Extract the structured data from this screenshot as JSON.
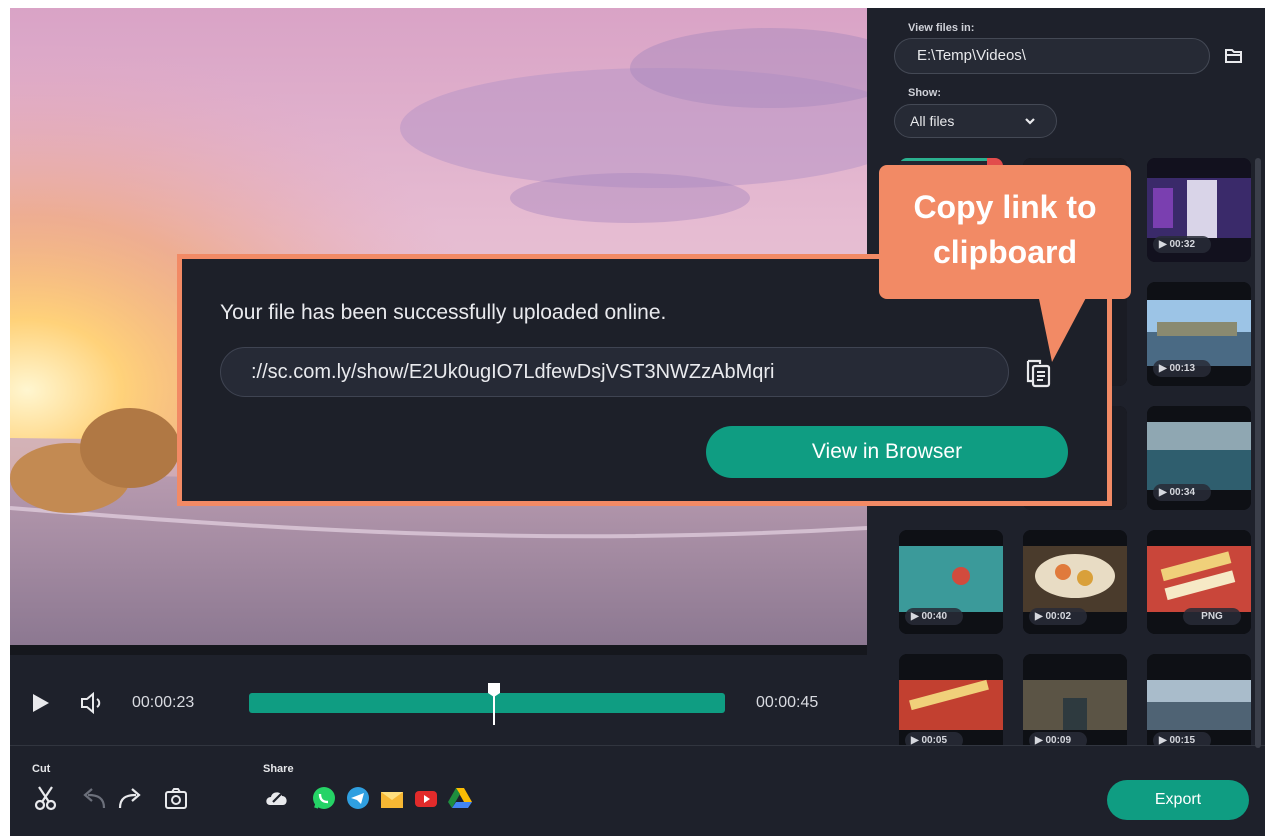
{
  "player": {
    "current_time": "00:00:23",
    "total_time": "00:00:45",
    "progress": 0.51
  },
  "side_panel": {
    "view_files_label": "View files in:",
    "path": "E:\\Temp\\Videos\\",
    "show_label": "Show:",
    "show_value": "All files",
    "thumbnails": [
      {
        "badge": ""
      },
      {
        "badge": ""
      },
      {
        "badge": "▶ 00:32"
      },
      {
        "badge": "▶ 00:13"
      },
      {
        "badge": "▶ 00:34"
      },
      {
        "badge": "▶ 00:40"
      },
      {
        "badge": "▶ 00:02"
      },
      {
        "badge": "PNG"
      },
      {
        "badge": "▶ 00:05"
      },
      {
        "badge": "▶ 00:09"
      },
      {
        "badge": "▶ 00:15"
      }
    ]
  },
  "toolbar": {
    "cut_label": "Cut",
    "share_label": "Share",
    "export_label": "Export"
  },
  "dialog": {
    "message": "Your file has been successfully uploaded online.",
    "link": "://sc.com.ly/show/E2Uk0ugIO7LdfewDsjVST3NWZzAbMqri",
    "view_button": "View in Browser"
  },
  "callout": {
    "text_line1": "Copy link to",
    "text_line2": "clipboard"
  },
  "colors": {
    "accent": "#0f9d82",
    "callout": "#f28a65",
    "background": "#1e212b"
  }
}
